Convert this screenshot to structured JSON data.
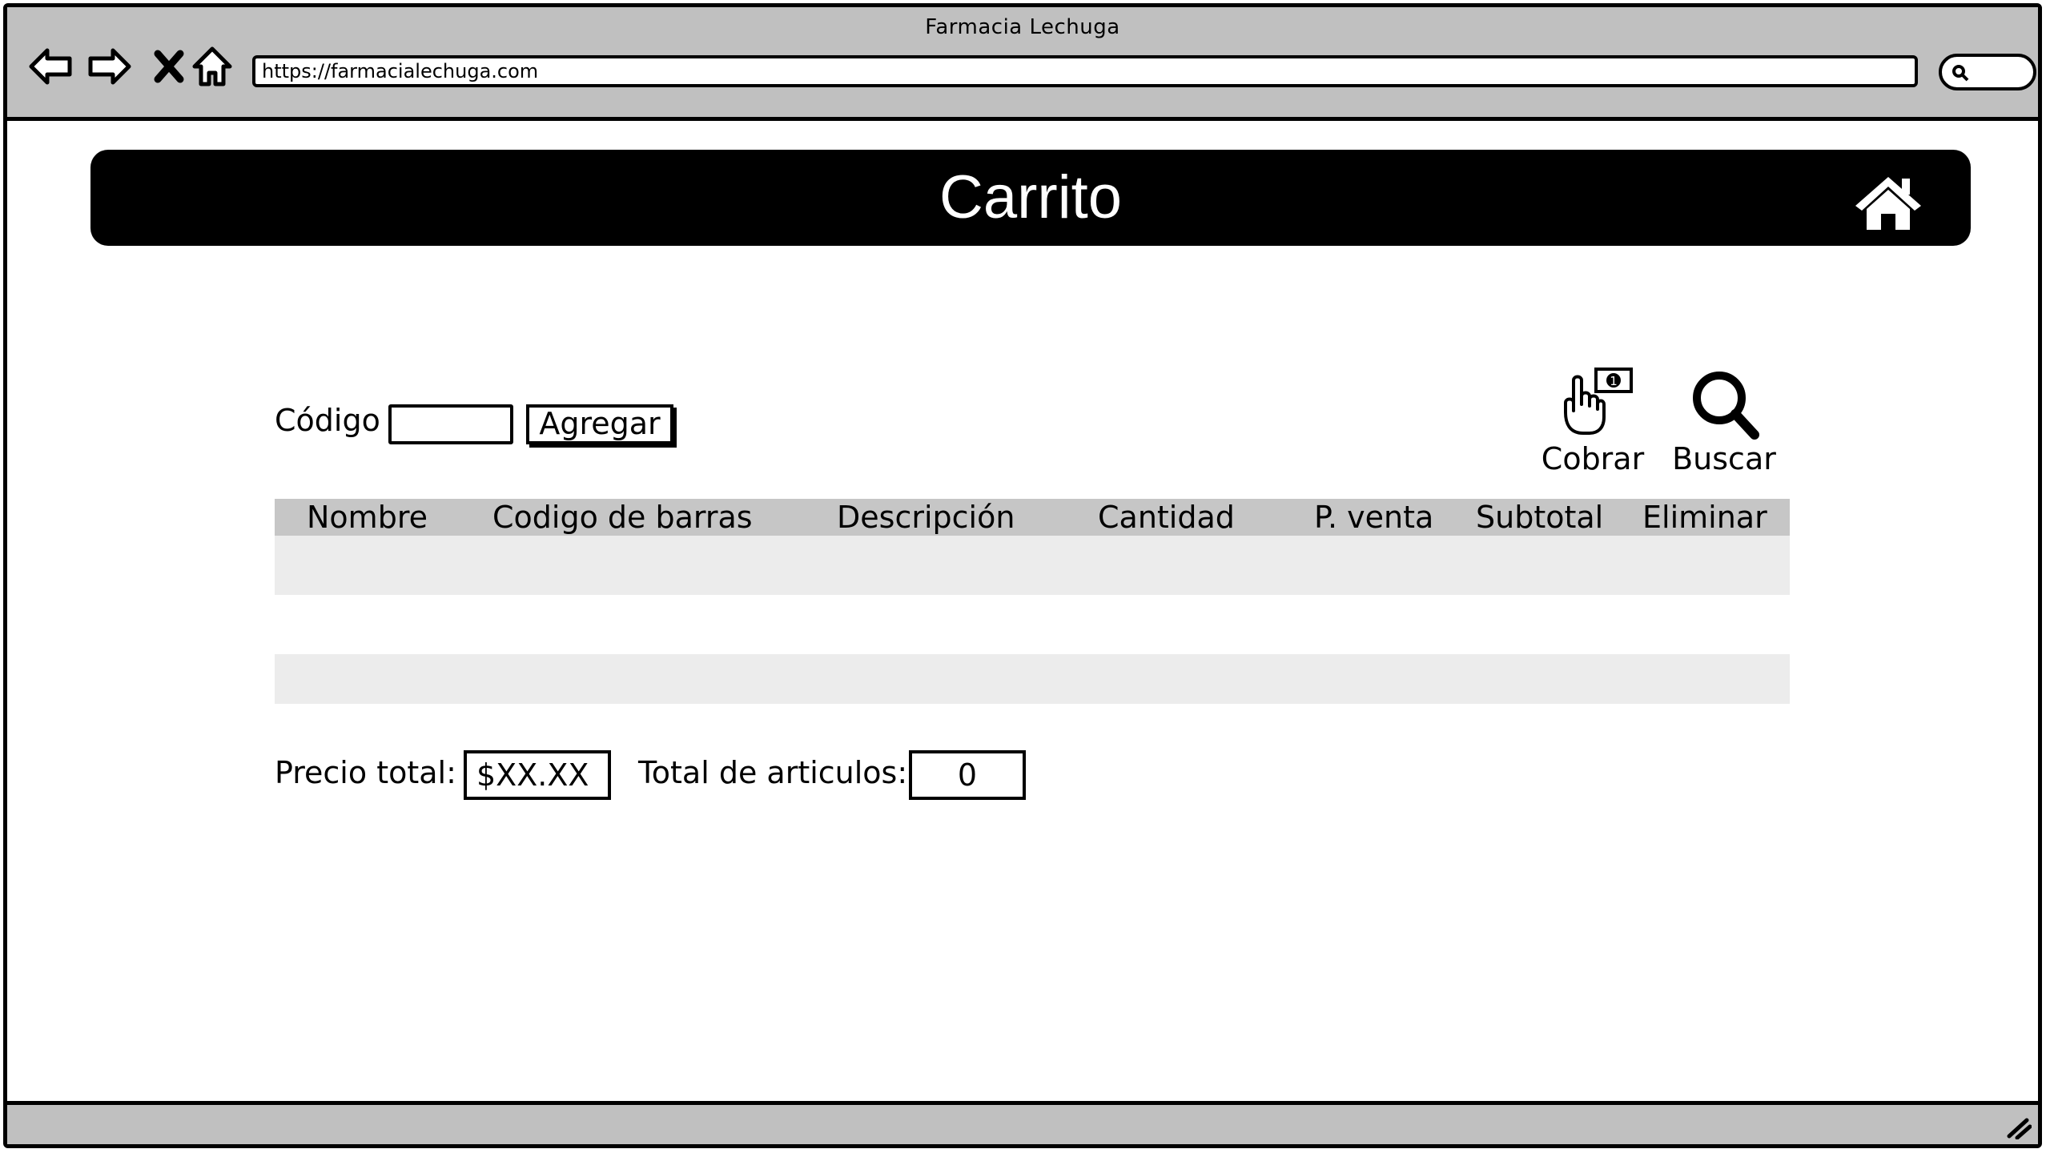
{
  "window": {
    "title": "Farmacia Lechuga"
  },
  "browser": {
    "url": "https://farmacialechuga.com",
    "nav_icons": [
      "back-arrow-icon",
      "forward-arrow-icon",
      "close-x-icon",
      "home-outline-icon"
    ],
    "search_icon": "magnifier-icon"
  },
  "header": {
    "title": "Carrito",
    "home_icon": "home-icon"
  },
  "form": {
    "codigo_label": "Código",
    "codigo_value": "",
    "agregar_label": "Agregar"
  },
  "actions": [
    {
      "label": "Cobrar",
      "icon": "hand-money-icon"
    },
    {
      "label": "Buscar",
      "icon": "search-icon"
    }
  ],
  "table": {
    "columns": [
      "Nombre",
      "Codigo de barras",
      "Descripción",
      "Cantidad",
      "P. venta",
      "Subtotal",
      "Eliminar"
    ],
    "rows": []
  },
  "totals": {
    "precio_label": "Precio total:",
    "precio_value": "$XX.XX",
    "articulos_label": "Total de articulos:",
    "articulos_value": "0"
  },
  "colors": {
    "header_bg": "#000000",
    "chrome": "#c0c0c0",
    "table_header": "#c6c6c6",
    "row_stripe": "#ececec"
  }
}
